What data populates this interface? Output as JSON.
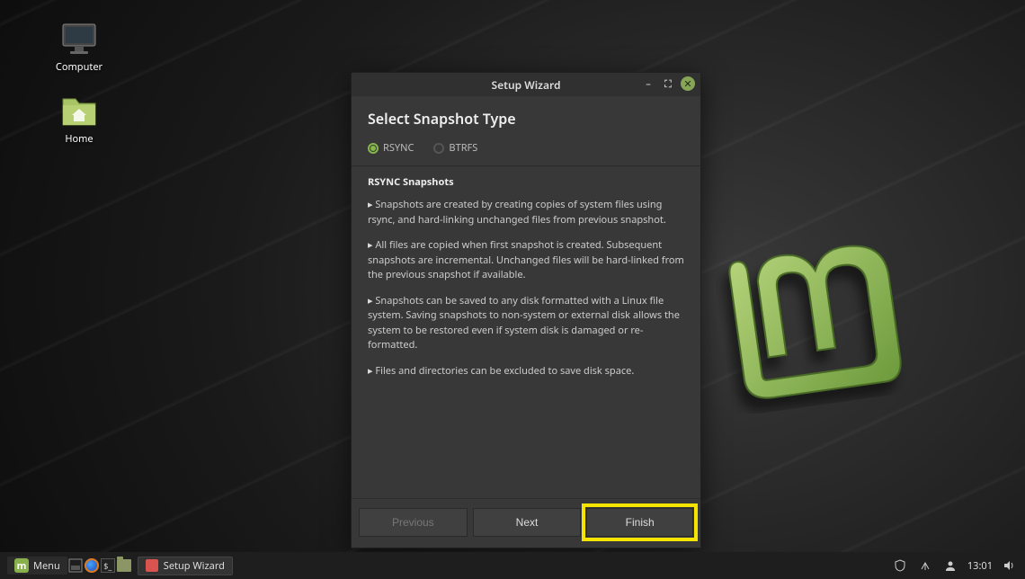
{
  "desktop": {
    "icons": {
      "computer": "Computer",
      "home": "Home"
    }
  },
  "window": {
    "title": "Setup Wizard",
    "heading": "Select Snapshot Type",
    "radio_rsync": "RSYNC",
    "radio_btrfs": "BTRFS",
    "section_title": "RSYNC Snapshots",
    "bullets": [
      "Snapshots are created by creating copies of system files using rsync, and hard-linking unchanged files from previous snapshot.",
      "All files are copied when first snapshot is created. Subsequent snapshots are incremental. Unchanged files will be hard-linked from the previous snapshot if available.",
      "Snapshots can be saved to any disk formatted with a Linux file system. Saving snapshots to non-system or external disk allows the system to be restored even if system disk is damaged or re-formatted.",
      "Files and directories can be excluded to save disk space."
    ],
    "buttons": {
      "prev": "Previous",
      "next": "Next",
      "finish": "Finish"
    }
  },
  "taskbar": {
    "menu": "Menu",
    "running": "Setup Wizard",
    "clock": "13:01"
  }
}
